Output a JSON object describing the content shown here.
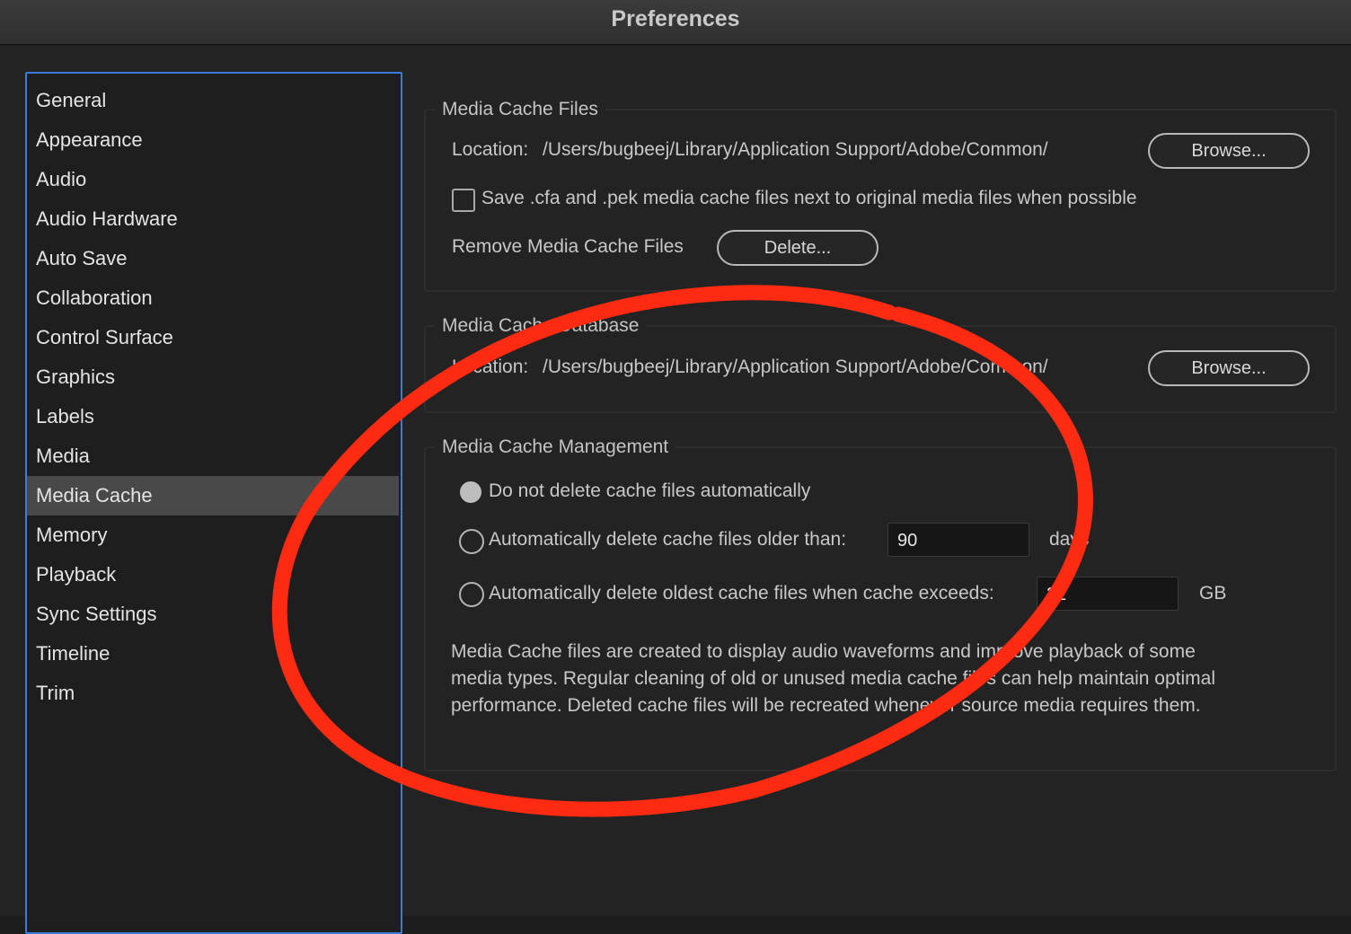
{
  "window": {
    "title": "Preferences"
  },
  "sidebar": {
    "items": [
      {
        "label": "General"
      },
      {
        "label": "Appearance"
      },
      {
        "label": "Audio"
      },
      {
        "label": "Audio Hardware"
      },
      {
        "label": "Auto Save"
      },
      {
        "label": "Collaboration"
      },
      {
        "label": "Control Surface"
      },
      {
        "label": "Graphics"
      },
      {
        "label": "Labels"
      },
      {
        "label": "Media"
      },
      {
        "label": "Media Cache",
        "selected": true
      },
      {
        "label": "Memory"
      },
      {
        "label": "Playback"
      },
      {
        "label": "Sync Settings"
      },
      {
        "label": "Timeline"
      },
      {
        "label": "Trim"
      }
    ]
  },
  "cache_files": {
    "title": "Media Cache Files",
    "location_label": "Location:",
    "location_path": "/Users/bugbeej/Library/Application Support/Adobe/Common/",
    "browse_label": "Browse...",
    "save_checkbox_label": "Save .cfa and .pek media cache files next to original media files when possible",
    "save_checkbox_checked": false,
    "remove_label": "Remove Media Cache Files",
    "delete_label": "Delete..."
  },
  "cache_database": {
    "title": "Media Cache Database",
    "location_label": "Location:",
    "location_path": "/Users/bugbeej/Library/Application Support/Adobe/Common/",
    "browse_label": "Browse..."
  },
  "cache_management": {
    "title": "Media Cache Management",
    "option_none_label": "Do not delete cache files automatically",
    "option_age_label": "Automatically delete cache files older than:",
    "option_age_value": "90",
    "option_age_unit": "days",
    "option_size_label": "Automatically delete oldest cache files when cache exceeds:",
    "option_size_value": "32",
    "option_size_unit": "GB",
    "selected_option": "none",
    "description": "Media Cache files are created to display audio waveforms and improve playback of some media types.  Regular cleaning of old or unused media cache files can help maintain optimal performance. Deleted cache files will be recreated whenever source media requires them."
  },
  "colors": {
    "selection_border": "#3a7bd5",
    "annotation": "#ff2a12",
    "background": "#232323"
  }
}
